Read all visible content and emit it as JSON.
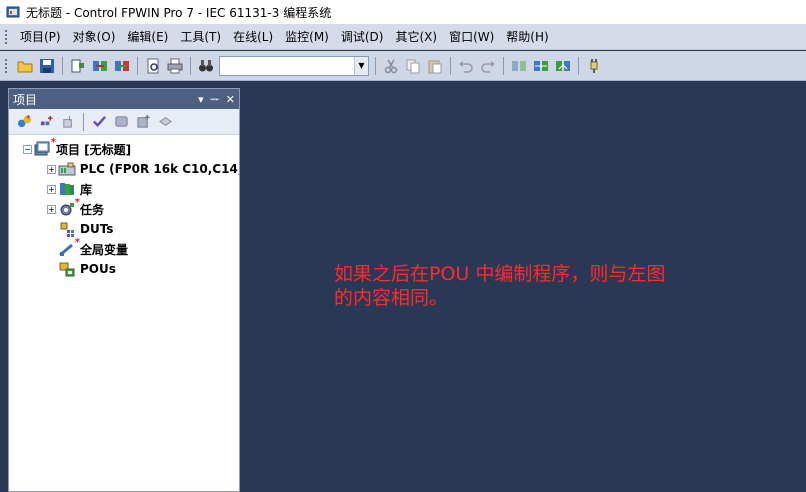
{
  "window": {
    "title": "无标题 - Control FPWIN Pro 7 - IEC 61131-3 编程系统"
  },
  "menu": {
    "items": [
      "项目(P)",
      "对象(O)",
      "编辑(E)",
      "工具(T)",
      "在线(L)",
      "监控(M)",
      "调试(D)",
      "其它(X)",
      "窗口(W)",
      "帮助(H)"
    ]
  },
  "toolbar": {
    "search_value": ""
  },
  "project_panel": {
    "title": "项目",
    "pin_glyph": "ᅲ",
    "tree": {
      "root": "项目 [无标题]",
      "plc": "PLC (FP0R 16k C10,C14,C",
      "library": "库",
      "tasks": "任务",
      "duts": "DUTs",
      "globals": "全局变量",
      "pous": "POUs"
    }
  },
  "annotation": {
    "line1": "如果之后在POU 中编制程序，则与左图",
    "line2": "的内容相同。"
  },
  "colors": {
    "workspace": "#293955",
    "panel_header": "#4d6082",
    "annotation": "#ff2a2a"
  }
}
